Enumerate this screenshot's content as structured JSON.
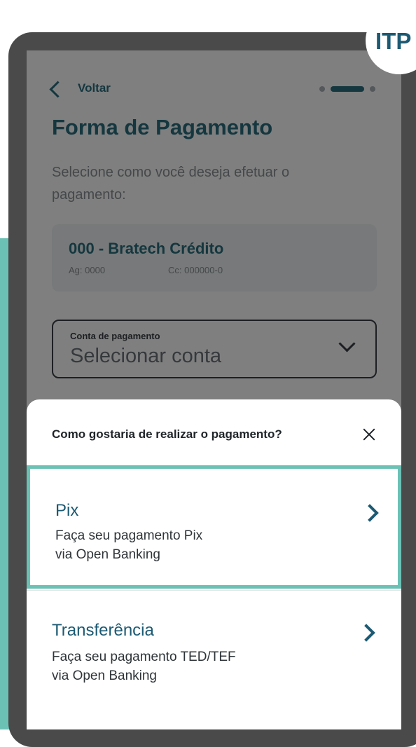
{
  "header": {
    "back_label": "Voltar"
  },
  "page": {
    "title": "Forma de Pagamento",
    "subtitle": "Selecione como você deseja efetuar o pagamento:"
  },
  "bank": {
    "name": "000 - Bratech Crédito",
    "agency": "Ag: 0000",
    "account": "Cc: 000000-0"
  },
  "account_select": {
    "label": "Conta de pagamento",
    "placeholder": "Selecionar conta"
  },
  "sheet": {
    "title": "Como gostaria de realizar o pagamento?",
    "options": [
      {
        "title": "Pix",
        "desc1": "Faça seu pagamento Pix",
        "desc2": "via Open Banking"
      },
      {
        "title": "Transferência",
        "desc1": "Faça seu pagamento TED/TEF",
        "desc2": "via Open Banking"
      }
    ]
  },
  "badge": {
    "text": "ITP"
  },
  "colors": {
    "accent": "#6cc1b5",
    "primary": "#2b6e7e",
    "dark_frame": "#4a4a4a"
  }
}
